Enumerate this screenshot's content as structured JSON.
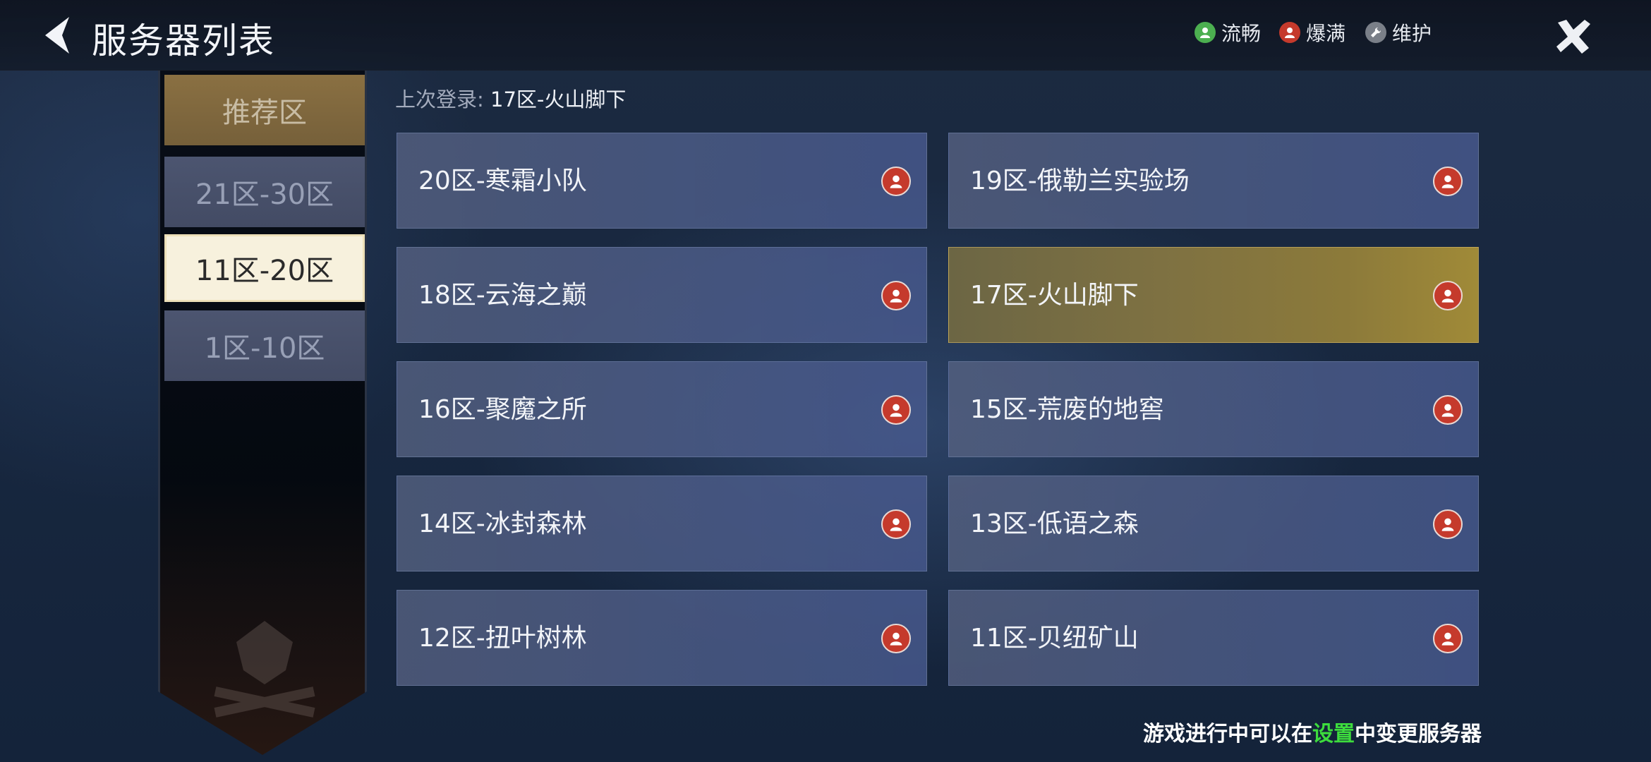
{
  "header": {
    "title": "服务器列表",
    "legend": [
      {
        "label": "流畅",
        "color": "#4caf50",
        "icon": "person-icon"
      },
      {
        "label": "爆满",
        "color": "#c53a2c",
        "icon": "person-icon"
      },
      {
        "label": "维护",
        "color": "#7a7f88",
        "icon": "wrench-icon"
      }
    ]
  },
  "sidebar": {
    "tabs": [
      {
        "label": "推荐区",
        "state": "normal"
      },
      {
        "label": "21区-30区",
        "state": "normal"
      },
      {
        "label": "11区-20区",
        "state": "active"
      },
      {
        "label": "1区-10区",
        "state": "normal"
      }
    ]
  },
  "last_login": {
    "label": "上次登录:",
    "value": "17区-火山脚下"
  },
  "servers": [
    {
      "name": "20区-寒霜小队",
      "status": "爆满"
    },
    {
      "name": "19区-俄勒兰实验场",
      "status": "爆满"
    },
    {
      "name": "18区-云海之巅",
      "status": "爆满"
    },
    {
      "name": "17区-火山脚下",
      "status": "爆满",
      "selected": true
    },
    {
      "name": "16区-聚魔之所",
      "status": "爆满"
    },
    {
      "name": "15区-荒废的地窖",
      "status": "爆满"
    },
    {
      "name": "14区-冰封森林",
      "status": "爆满"
    },
    {
      "name": "13区-低语之森",
      "status": "爆满"
    },
    {
      "name": "12区-扭叶树林",
      "status": "爆满"
    },
    {
      "name": "11区-贝纽矿山",
      "status": "爆满"
    }
  ],
  "footer": {
    "prefix": "游戏进行中可以在",
    "highlight": "设置",
    "suffix": "中变更服务器",
    "highlight_color": "#3ddc3d"
  }
}
